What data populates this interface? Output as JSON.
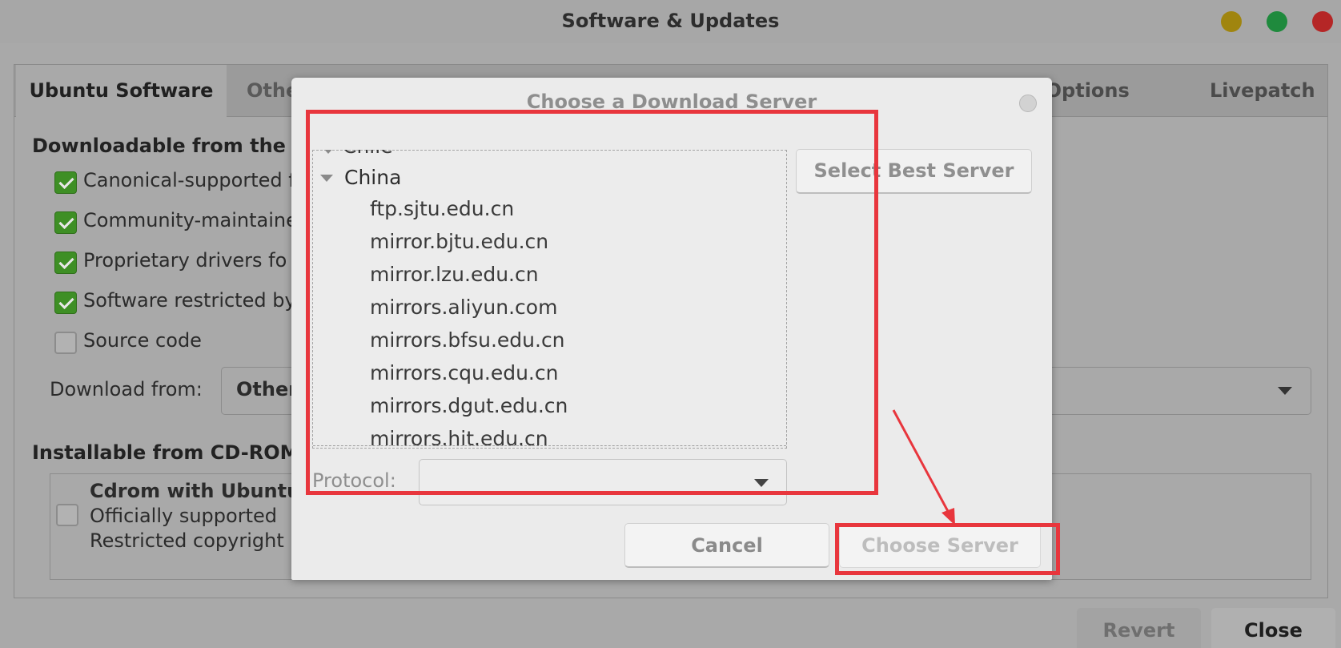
{
  "window": {
    "title": "Software & Updates"
  },
  "tabs": [
    {
      "label": "Ubuntu Software",
      "active": true
    },
    {
      "label": "Othe"
    },
    {
      "label": "per Options"
    },
    {
      "label": "Livepatch"
    }
  ],
  "downloadable": {
    "heading": "Downloadable from the In",
    "items": [
      {
        "label": "Canonical-supported f",
        "checked": true
      },
      {
        "label": "Community-maintaine",
        "checked": true
      },
      {
        "label": "Proprietary drivers fo",
        "checked": true
      },
      {
        "label": "Software restricted by",
        "checked": true
      },
      {
        "label": "Source code",
        "checked": false
      }
    ],
    "download_from_label": "Download from:",
    "download_from_value": "Other"
  },
  "cdrom": {
    "heading": "Installable from CD-ROM/",
    "title": "Cdrom with Ubuntu",
    "line1": "Officially supported",
    "line2": "Restricted copyright",
    "checked": false
  },
  "footer": {
    "revert_label": "Revert",
    "close_label": "Close"
  },
  "dialog": {
    "title": "Choose a Download Server",
    "partial_country": "Chile",
    "country": "China",
    "mirrors": [
      "ftp.sjtu.edu.cn",
      "mirror.bjtu.edu.cn",
      "mirror.lzu.edu.cn",
      "mirrors.aliyun.com",
      "mirrors.bfsu.edu.cn",
      "mirrors.cqu.edu.cn",
      "mirrors.dgut.edu.cn",
      "mirrors.hit.edu.cn"
    ],
    "best_server_label": "Select Best Server",
    "protocol_label": "Protocol:",
    "protocol_value": "",
    "cancel_label": "Cancel",
    "choose_label": "Choose Server"
  },
  "colors": {
    "annotation": "#e8363d",
    "check_green": "#3e8f25"
  }
}
